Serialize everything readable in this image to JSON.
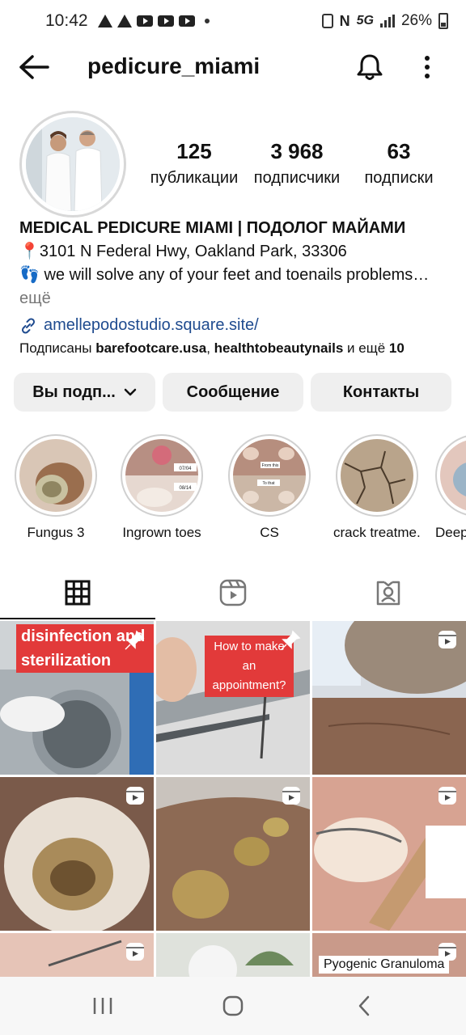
{
  "status": {
    "time": "10:42",
    "network": "5G",
    "battery": "26%"
  },
  "header": {
    "username": "pedicure_miami"
  },
  "stats": {
    "posts": {
      "value": "125",
      "label": "публикации"
    },
    "followers": {
      "value": "3 968",
      "label": "подписчики"
    },
    "following": {
      "value": "63",
      "label": "подписки"
    }
  },
  "bio": {
    "name": "MEDICAL PEDICURE MIAMI | ПОДОЛОГ МАЙАМИ",
    "line1": "📍3101 N Federal Hwy, Oakland Park, 33306",
    "line2": "👣 we will solve any of your feet and toenails problems…",
    "more": "ещё",
    "link": "amellepodostudio.square.site/"
  },
  "followed_by": {
    "prefix": "Подписаны ",
    "user1": "barefootcare.usa",
    "sep": ", ",
    "user2": "healthtobeautynails",
    "suffix": " и ещё ",
    "count": "10"
  },
  "buttons": {
    "following": "Вы подп...",
    "message": "Сообщение",
    "contacts": "Контакты"
  },
  "highlights": [
    {
      "label": "Fungus 3"
    },
    {
      "label": "Ingrown toes"
    },
    {
      "label": "CS"
    },
    {
      "label": "crack treatme..."
    },
    {
      "label": "Deep"
    }
  ],
  "highlight_texts": {
    "h2_a": "07/04",
    "h2_b": "08/14",
    "h3_a": "From this",
    "h3_b": "To that"
  },
  "posts": {
    "p1": "disinfection and sterilization",
    "p2": "How to make an appointment?",
    "p9": "Pyogenic Granuloma"
  },
  "colors": {
    "accent_link": "#1f4b8f",
    "button_bg": "#efefef",
    "caption_red": "#e23a3a"
  }
}
